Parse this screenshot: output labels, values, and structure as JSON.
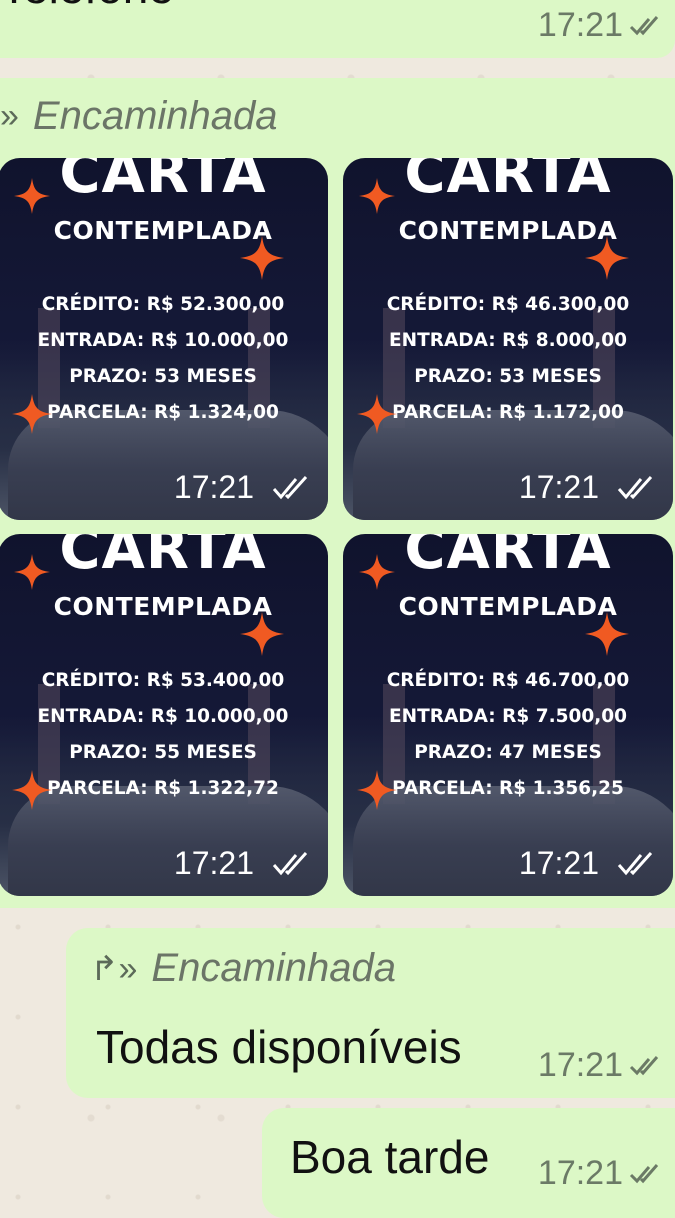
{
  "messages": {
    "top": {
      "text": "Telefone",
      "time": "17:21"
    },
    "forward_group": {
      "forwarded_label": "Encaminhada",
      "cards": [
        {
          "title": "CARTA",
          "subtitle": "CONTEMPLADA",
          "credito": "CRÉDITO: R$ 52.300,00",
          "entrada": "ENTRADA: R$ 10.000,00",
          "prazo": "PRAZO: 53 MESES",
          "parcela": "PARCELA: R$ 1.324,00",
          "time": "17:21"
        },
        {
          "title": "CARTA",
          "subtitle": "CONTEMPLADA",
          "credito": "CRÉDITO: R$ 46.300,00",
          "entrada": "ENTRADA: R$ 8.000,00",
          "prazo": "PRAZO: 53 MESES",
          "parcela": "PARCELA: R$ 1.172,00",
          "time": "17:21"
        },
        {
          "title": "CARTA",
          "subtitle": "CONTEMPLADA",
          "credito": "CRÉDITO: R$ 53.400,00",
          "entrada": "ENTRADA: R$ 10.000,00",
          "prazo": "PRAZO: 55 MESES",
          "parcela": "PARCELA: R$ 1.322,72",
          "time": "17:21"
        },
        {
          "title": "CARTA",
          "subtitle": "CONTEMPLADA",
          "credito": "CRÉDITO: R$ 46.700,00",
          "entrada": "ENTRADA: R$ 7.500,00",
          "prazo": "PRAZO: 47 MESES",
          "parcela": "PARCELA: R$ 1.356,25",
          "time": "17:21"
        }
      ]
    },
    "available": {
      "forwarded_label": "Encaminhada",
      "text": "Todas disponíveis",
      "time": "17:21"
    },
    "greeting": {
      "text": "Boa tarde",
      "time": "17:21"
    }
  },
  "icons": {
    "forward": "forward-icon",
    "tick": "double-check-icon",
    "sparkle": "sparkle-icon"
  },
  "colors": {
    "bubble": "#dcf8c6",
    "wallpaper": "#efe9df",
    "card_bg": "#10132d",
    "sparkle": "#f05a22"
  }
}
